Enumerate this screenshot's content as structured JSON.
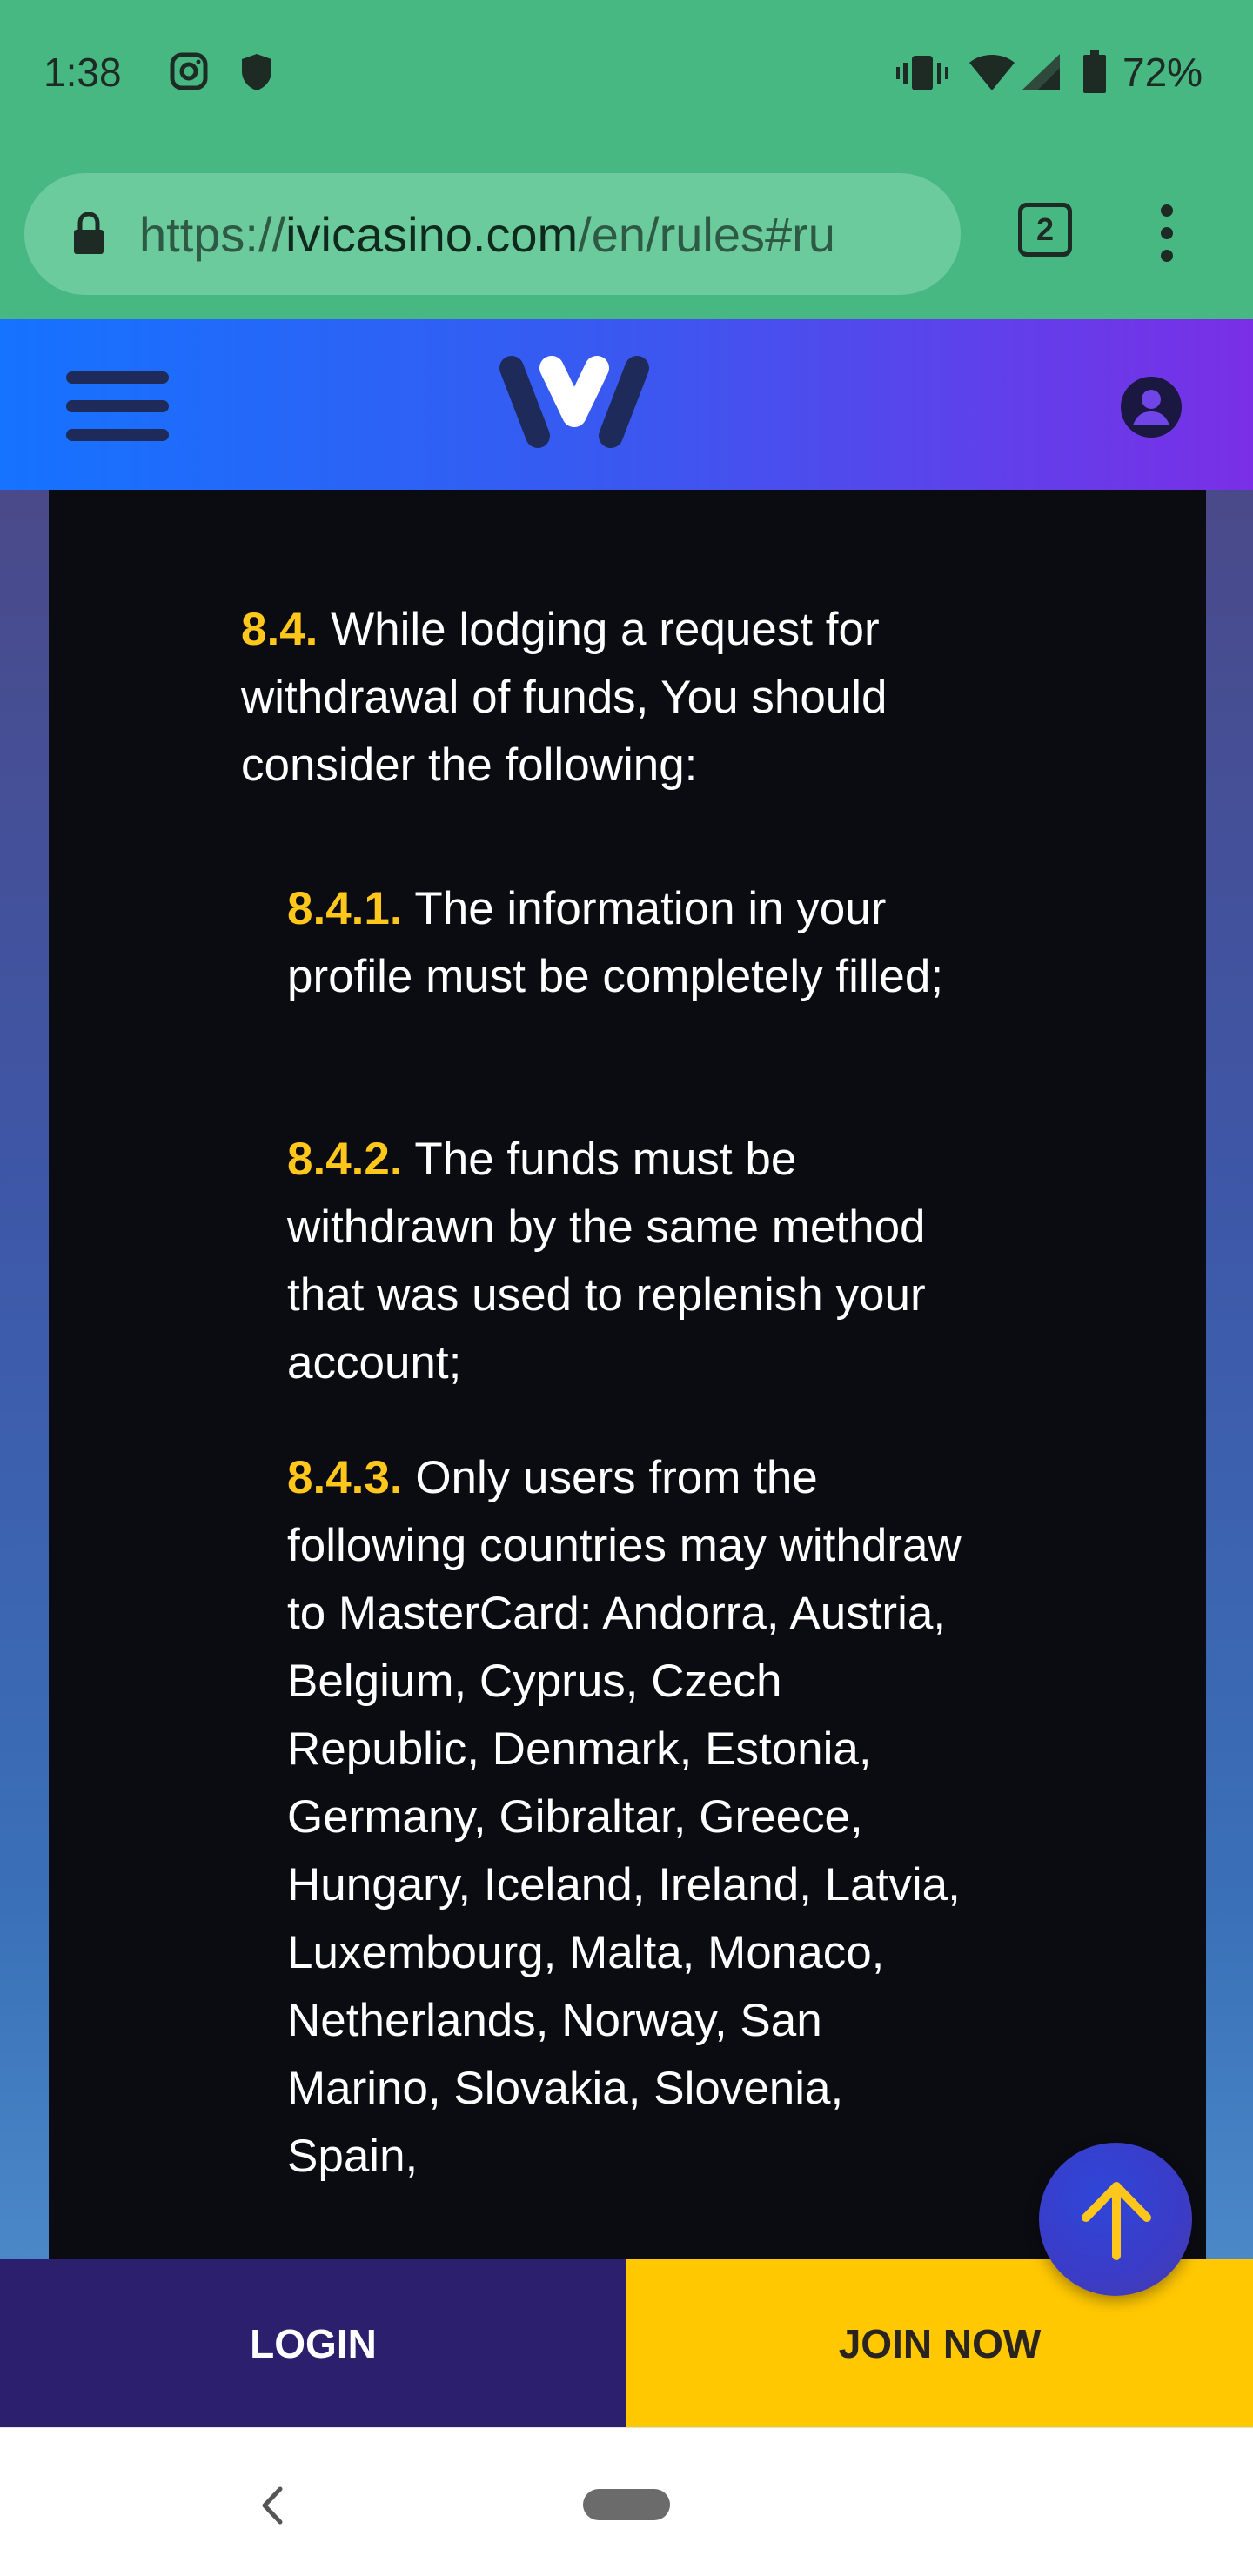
{
  "status_bar": {
    "time": "1:38",
    "battery": "72%",
    "icons": [
      "instagram-icon",
      "shield-icon",
      "vibrate-icon",
      "wifi-icon",
      "signal-icon",
      "battery-icon"
    ]
  },
  "browser": {
    "url_prefix": "https://",
    "url_domain": "ivicasino.com",
    "url_path": "/en/rules#ru",
    "tab_count": "2"
  },
  "header": {
    "menu_icon": "hamburger-icon",
    "logo_icon": "ivi-logo-icon",
    "account_icon": "account-icon"
  },
  "rules": {
    "main": {
      "number": "8.4.",
      "text": " While lodging a request for withdrawal of funds, You should consider the following:"
    },
    "sub": [
      {
        "number": "8.4.1.",
        "text": " The information in your profile must be completely filled;"
      },
      {
        "number": "8.4.2.",
        "text": " The funds must be withdrawn by the same method that was used to replenish your account;"
      },
      {
        "number": "8.4.3.",
        "text": " Only users from the following countries may withdraw to MasterCard: Andorra, Austria, Belgium, Cyprus, Czech Republic, Denmark, Estonia, Germany, Gibraltar, Greece, Hungary, Iceland, Ireland, Latvia, Luxembourg, Malta, Monaco, Netherlands, Norway, San Marino, Slovakia, Slovenia, Spain,"
      }
    ]
  },
  "actions": {
    "login_label": "LOGIN",
    "join_label": "JOIN NOW",
    "scroll_top_icon": "arrow-up-icon"
  },
  "colors": {
    "status_green": "#47b882",
    "accent_yellow": "#ffc61b",
    "login_bg": "#2b1f6e",
    "join_bg": "#ffc800"
  }
}
